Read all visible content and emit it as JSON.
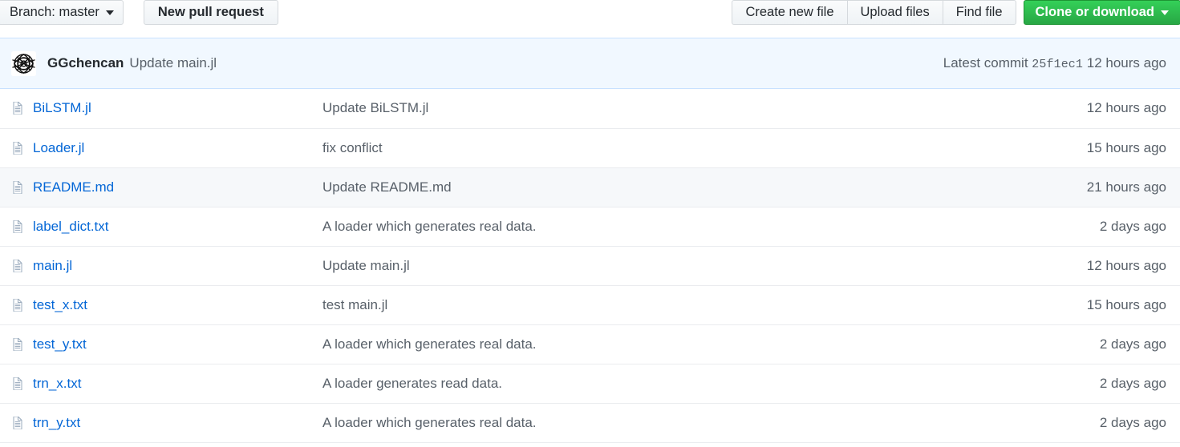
{
  "toolbar": {
    "branch_button": {
      "label": "Branch: master",
      "icon": "chevron-down-icon"
    },
    "new_pull_request_button": {
      "label": "New pull request"
    },
    "create_new_file_button": {
      "label": "Create new file"
    },
    "upload_files_button": {
      "label": "Upload files"
    },
    "find_file_button": {
      "label": "Find file"
    },
    "clone_button": {
      "label": "Clone or download",
      "icon": "chevron-down-icon",
      "color": "#28a745"
    }
  },
  "commit_bar": {
    "avatar_alt": "avatar",
    "author": "GGchencan",
    "message": "Update main.jl",
    "latest_commit_label": "Latest commit",
    "sha": "25f1ec1",
    "age": "12 hours ago",
    "background": "#f1f8ff",
    "border": "#c8e1ff"
  },
  "file_list": {
    "file_icon_name": "file-icon",
    "rows": [
      {
        "name": "BiLSTM.jl",
        "message": "Update BiLSTM.jl",
        "age": "12 hours ago",
        "hovered": false
      },
      {
        "name": "Loader.jl",
        "message": "fix conflict",
        "age": "15 hours ago",
        "hovered": false
      },
      {
        "name": "README.md",
        "message": "Update README.md",
        "age": "21 hours ago",
        "hovered": true
      },
      {
        "name": "label_dict.txt",
        "message": "A loader which generates real data.",
        "age": "2 days ago",
        "hovered": false
      },
      {
        "name": "main.jl",
        "message": "Update main.jl",
        "age": "12 hours ago",
        "hovered": false
      },
      {
        "name": "test_x.txt",
        "message": "test main.jl",
        "age": "15 hours ago",
        "hovered": false
      },
      {
        "name": "test_y.txt",
        "message": "A loader which generates real data.",
        "age": "2 days ago",
        "hovered": false
      },
      {
        "name": "trn_x.txt",
        "message": "A loader generates read data.",
        "age": "2 days ago",
        "hovered": false
      },
      {
        "name": "trn_y.txt",
        "message": "A loader which generates real data.",
        "age": "2 days ago",
        "hovered": false
      }
    ]
  },
  "colors": {
    "link": "#0366d6",
    "muted": "#586069",
    "text": "#24292e",
    "row_border": "#eaecef",
    "row_hover": "#f6f8fa"
  }
}
